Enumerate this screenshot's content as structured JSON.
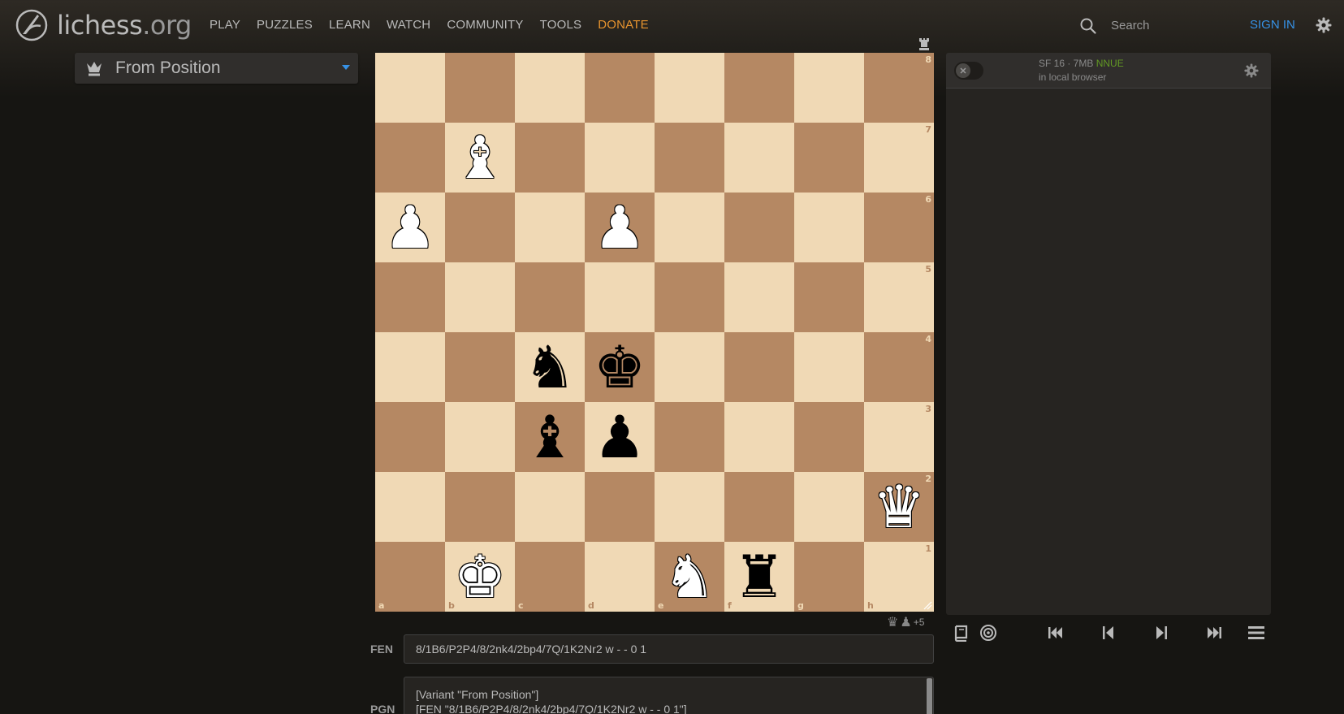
{
  "header": {
    "logo_main": "lichess",
    "logo_tld": ".org",
    "nav": [
      {
        "label": "PLAY"
      },
      {
        "label": "PUZZLES"
      },
      {
        "label": "LEARN"
      },
      {
        "label": "WATCH"
      },
      {
        "label": "COMMUNITY"
      },
      {
        "label": "TOOLS"
      },
      {
        "label": "DONATE"
      }
    ],
    "search_placeholder": "Search",
    "sign_in": "SIGN IN"
  },
  "variant": {
    "selected": "From Position"
  },
  "board": {
    "orientation": "white",
    "light_color": "#f0d9b5",
    "dark_color": "#b58863",
    "files": [
      "a",
      "b",
      "c",
      "d",
      "e",
      "f",
      "g",
      "h"
    ],
    "ranks": [
      "8",
      "7",
      "6",
      "5",
      "4",
      "3",
      "2",
      "1"
    ],
    "pieces": [
      {
        "square": "b7",
        "color": "w",
        "type": "bishop",
        "glyph": "♝"
      },
      {
        "square": "a6",
        "color": "w",
        "type": "pawn",
        "glyph": "♟"
      },
      {
        "square": "d6",
        "color": "w",
        "type": "pawn",
        "glyph": "♟"
      },
      {
        "square": "c4",
        "color": "b",
        "type": "knight",
        "glyph": "♞"
      },
      {
        "square": "d4",
        "color": "b",
        "type": "king",
        "glyph": "♚"
      },
      {
        "square": "c3",
        "color": "b",
        "type": "bishop",
        "glyph": "♝"
      },
      {
        "square": "d3",
        "color": "b",
        "type": "pawn",
        "glyph": "♟"
      },
      {
        "square": "h2",
        "color": "w",
        "type": "queen",
        "glyph": "♛"
      },
      {
        "square": "b1",
        "color": "w",
        "type": "king",
        "glyph": "♚"
      },
      {
        "square": "e1",
        "color": "w",
        "type": "knight",
        "glyph": "♞"
      },
      {
        "square": "f1",
        "color": "b",
        "type": "rook",
        "glyph": "♜"
      }
    ]
  },
  "material": {
    "icons": [
      "queen-icon",
      "pawn-icon"
    ],
    "diff": "+5"
  },
  "fen": {
    "label": "FEN",
    "value": "8/1B6/P2P4/8/2nk4/2bp4/7Q/1K2Nr2 w - - 0 1"
  },
  "pgn": {
    "label": "PGN",
    "lines": [
      "[Variant \"From Position\"]",
      "[FEN \"8/1B6/P2P4/8/2nk4/2bp4/7Q/1K2Nr2 w - - 0 1\"]"
    ]
  },
  "engine": {
    "name": "SF 16 · 7MB",
    "flavor": "NNUE",
    "location": "in local browser",
    "enabled": false
  },
  "colors": {
    "accent": "#3692e7",
    "donate": "#e8942e",
    "nnue": "#629924"
  }
}
